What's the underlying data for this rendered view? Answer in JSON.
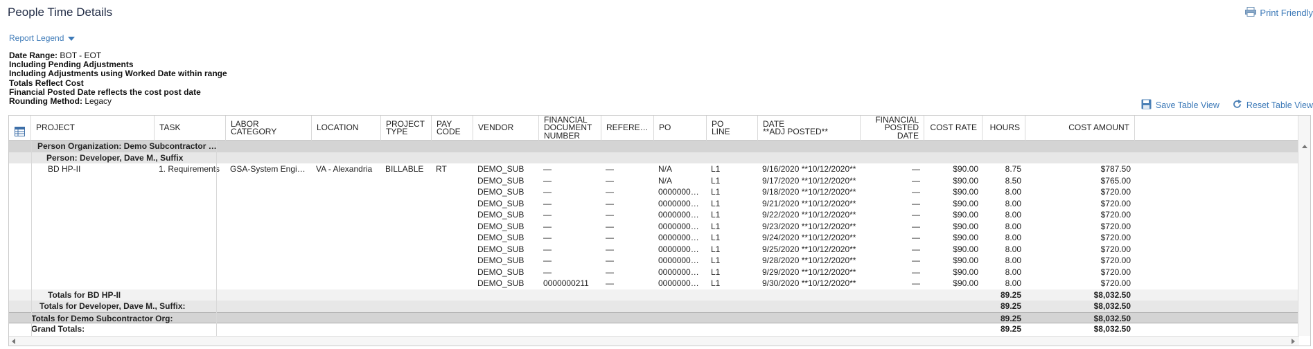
{
  "page": {
    "title": "People Time Details",
    "print_label": "Print Friendly",
    "legend_label": "Report Legend"
  },
  "criteria": {
    "date_range_label": "Date Range:",
    "date_range_value": "BOT - EOT",
    "line2": "Including Pending Adjustments",
    "line3": "Including Adjustments using Worked Date within range",
    "line4": "Totals Reflect Cost",
    "line5": "Financial Posted Date reflects the cost post date",
    "rounding_label": "Rounding Method:",
    "rounding_value": "Legacy"
  },
  "toolbar": {
    "save_view": "Save Table View",
    "reset_view": "Reset Table View"
  },
  "columns": [
    "PROJECT",
    "TASK",
    "LABOR\nCATEGORY",
    "LOCATION",
    "PROJECT\nTYPE",
    "PAY\nCODE",
    "VENDOR",
    "FINANCIAL\nDOCUMENT\nNUMBER",
    "REFERE…",
    "PO",
    "PO\nLINE",
    "DATE\n**ADJ POSTED**",
    "FINANCIAL\nPOSTED\nDATE",
    "COST RATE",
    "HOURS",
    "COST AMOUNT"
  ],
  "groups": {
    "org": "Person Organization: Demo Subcontractor …",
    "person": "Person: Developer, Dave M., Suffix"
  },
  "first_row": {
    "project": "BD HP-II",
    "task": "1. Requirements",
    "labor_category": "GSA-System Engi…",
    "location": "VA - Alexandria",
    "project_type": "BILLABLE",
    "pay_code": "RT"
  },
  "rows": [
    {
      "vendor": "DEMO_SUB",
      "fin_doc": "—",
      "reference": "—",
      "po": "N/A",
      "po_line": "L1",
      "date": "9/16/2020 **10/12/2020**",
      "fin_posted": "—",
      "cost_rate": "$90.00",
      "hours": "8.75",
      "cost_amount": "$787.50"
    },
    {
      "vendor": "DEMO_SUB",
      "fin_doc": "—",
      "reference": "—",
      "po": "N/A",
      "po_line": "L1",
      "date": "9/17/2020 **10/12/2020**",
      "fin_posted": "—",
      "cost_rate": "$90.00",
      "hours": "8.50",
      "cost_amount": "$765.00"
    },
    {
      "vendor": "DEMO_SUB",
      "fin_doc": "—",
      "reference": "—",
      "po": "0000000…",
      "po_line": "L1",
      "date": "9/18/2020 **10/12/2020**",
      "fin_posted": "—",
      "cost_rate": "$90.00",
      "hours": "8.00",
      "cost_amount": "$720.00"
    },
    {
      "vendor": "DEMO_SUB",
      "fin_doc": "—",
      "reference": "—",
      "po": "0000000…",
      "po_line": "L1",
      "date": "9/21/2020 **10/12/2020**",
      "fin_posted": "—",
      "cost_rate": "$90.00",
      "hours": "8.00",
      "cost_amount": "$720.00"
    },
    {
      "vendor": "DEMO_SUB",
      "fin_doc": "—",
      "reference": "—",
      "po": "0000000…",
      "po_line": "L1",
      "date": "9/22/2020 **10/12/2020**",
      "fin_posted": "—",
      "cost_rate": "$90.00",
      "hours": "8.00",
      "cost_amount": "$720.00"
    },
    {
      "vendor": "DEMO_SUB",
      "fin_doc": "—",
      "reference": "—",
      "po": "0000000…",
      "po_line": "L1",
      "date": "9/23/2020 **10/12/2020**",
      "fin_posted": "—",
      "cost_rate": "$90.00",
      "hours": "8.00",
      "cost_amount": "$720.00"
    },
    {
      "vendor": "DEMO_SUB",
      "fin_doc": "—",
      "reference": "—",
      "po": "0000000…",
      "po_line": "L1",
      "date": "9/24/2020 **10/12/2020**",
      "fin_posted": "—",
      "cost_rate": "$90.00",
      "hours": "8.00",
      "cost_amount": "$720.00"
    },
    {
      "vendor": "DEMO_SUB",
      "fin_doc": "—",
      "reference": "—",
      "po": "0000000…",
      "po_line": "L1",
      "date": "9/25/2020 **10/12/2020**",
      "fin_posted": "—",
      "cost_rate": "$90.00",
      "hours": "8.00",
      "cost_amount": "$720.00"
    },
    {
      "vendor": "DEMO_SUB",
      "fin_doc": "—",
      "reference": "—",
      "po": "0000000…",
      "po_line": "L1",
      "date": "9/28/2020 **10/12/2020**",
      "fin_posted": "—",
      "cost_rate": "$90.00",
      "hours": "8.00",
      "cost_amount": "$720.00"
    },
    {
      "vendor": "DEMO_SUB",
      "fin_doc": "—",
      "reference": "—",
      "po": "0000000…",
      "po_line": "L1",
      "date": "9/29/2020 **10/12/2020**",
      "fin_posted": "—",
      "cost_rate": "$90.00",
      "hours": "8.00",
      "cost_amount": "$720.00"
    },
    {
      "vendor": "DEMO_SUB",
      "fin_doc": "0000000211",
      "reference": "—",
      "po": "0000000…",
      "po_line": "L1",
      "date": "9/30/2020 **10/12/2020**",
      "fin_posted": "—",
      "cost_rate": "$90.00",
      "hours": "8.00",
      "cost_amount": "$720.00"
    }
  ],
  "totals": [
    {
      "label": "Totals for BD HP-II",
      "hours": "89.25",
      "cost_amount": "$8,032.50"
    },
    {
      "label": "Totals for Developer, Dave M., Suffix:",
      "hours": "89.25",
      "cost_amount": "$8,032.50"
    },
    {
      "label": "Totals for Demo Subcontractor Org:",
      "hours": "89.25",
      "cost_amount": "$8,032.50"
    },
    {
      "label": "Grand Totals:",
      "hours": "89.25",
      "cost_amount": "$8,032.50"
    }
  ],
  "colors": {
    "link": "#3d7ab8",
    "group_dark": "#d4d4d4",
    "group_light": "#e7e7e7"
  }
}
